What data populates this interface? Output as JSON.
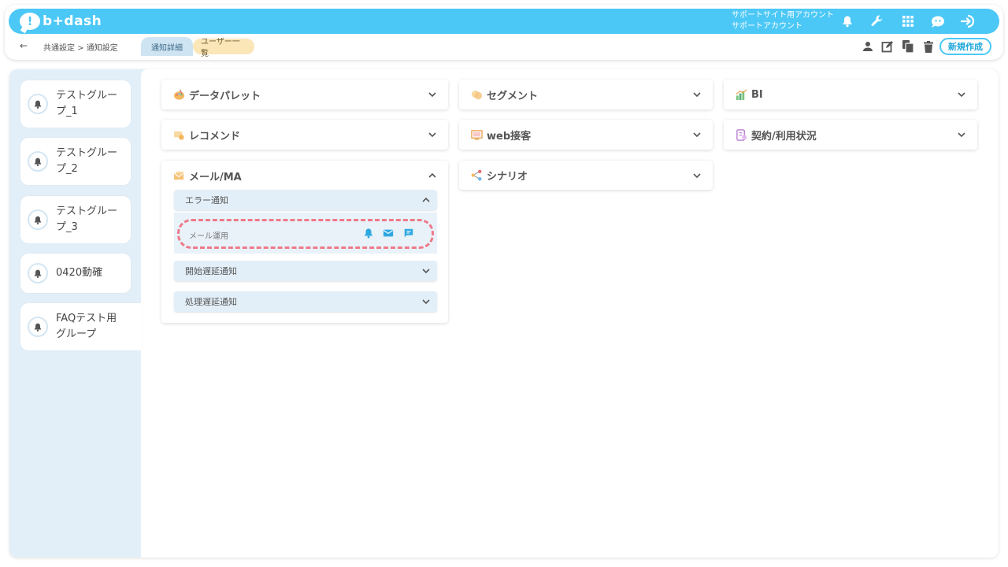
{
  "header": {
    "logo_text": "b+dash",
    "account_line1": "サポートサイト用アカウント",
    "account_line2": "サポートアカウント",
    "icons": [
      "bell-icon",
      "wrench-icon",
      "grid-icon",
      "support-icon",
      "logout-icon"
    ]
  },
  "subbar": {
    "back_symbol": "←",
    "breadcrumb": "共通設定 > 通知設定",
    "tabs": [
      {
        "label": "通知詳細",
        "active": true
      },
      {
        "label": "ユーザー一覧",
        "active": false
      }
    ],
    "new_button": "新規作成",
    "icons": [
      "user-icon",
      "edit-icon",
      "copy-icon",
      "trash-icon"
    ]
  },
  "sidebar": {
    "groups": [
      {
        "line1": "テストグルー",
        "line2": "プ_1"
      },
      {
        "line1": "テストグルー",
        "line2": "プ_2"
      },
      {
        "line1": "テストグルー",
        "line2": "プ_3"
      },
      {
        "line1": "0420動確",
        "line2": ""
      },
      {
        "line1": "FAQテスト用",
        "line2": "グループ",
        "active": true
      }
    ]
  },
  "cards": {
    "data_palette": "データパレット",
    "segment": "セグメント",
    "bi": "BI",
    "recommend": "レコメンド",
    "web": "web接客",
    "contract": "契約/利用状況",
    "mail": "メール/MA",
    "scenario": "シナリオ"
  },
  "mail_section": {
    "error_notice": "エラー通知",
    "row_label": "メール運用",
    "start_delay": "開始遅延通知",
    "process_delay": "処理遅延通知"
  },
  "colors": {
    "brand": "#4cc8f6",
    "sidebar_bg": "#e3eff8",
    "highlight": "#ee7a8a"
  }
}
